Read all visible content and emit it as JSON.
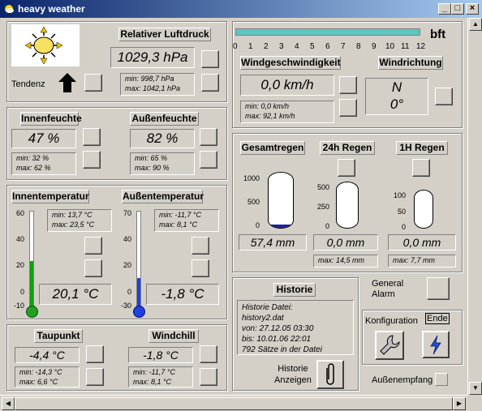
{
  "window": {
    "title": "heavy weather"
  },
  "pressure": {
    "label": "Relativer Luftdruck",
    "value": "1029,3 hPa",
    "min": "min: 998,7 hPa",
    "max": "max: 1042,1 hPa",
    "trend_label": "Tendenz"
  },
  "beaufort": {
    "unit": "bft",
    "ticks": [
      "0",
      "1",
      "2",
      "3",
      "4",
      "5",
      "6",
      "7",
      "8",
      "9",
      "10",
      "11",
      "12"
    ]
  },
  "wind": {
    "speed_label": "Windgeschwindigkeit",
    "speed_value": "0,0 km/h",
    "speed_min": "min: 0,0 km/h",
    "speed_max": "max: 92,1 km/h",
    "dir_label": "Windrichtung",
    "dir_value": "N",
    "dir_deg": "0°"
  },
  "humidity": {
    "in_label": "Innenfeuchte",
    "in_value": "47 %",
    "in_min": "min: 32 %",
    "in_max": "max: 62 %",
    "out_label": "Außenfeuchte",
    "out_value": "82 %",
    "out_min": "min: 65 %",
    "out_max": "max: 90 %"
  },
  "temperature": {
    "in_label": "Innentemperatur",
    "in_value": "20,1 °C",
    "in_min": "min: 13,7 °C",
    "in_max": "max: 23,5 °C",
    "in_ticks": [
      "60",
      "40",
      "20",
      "0",
      "-10"
    ],
    "in_level": 0.47,
    "out_label": "Außentemperatur",
    "out_value": "-1,8 °C",
    "out_min": "min: -11,7 °C",
    "out_max": "max: 8,1 °C",
    "out_ticks": [
      "70",
      "40",
      "20",
      "0",
      "-30"
    ],
    "out_level": 0.29
  },
  "rain": {
    "total_label": "Gesamtregen",
    "total_value": "57,4 mm",
    "total_ticks": [
      "1000",
      "500",
      "0"
    ],
    "total_level": 0.06,
    "h24_label": "24h Regen",
    "h24_value": "0,0 mm",
    "h24_ticks": [
      "500",
      "250",
      "0"
    ],
    "h24_max": "max: 14,5 mm",
    "h24_level": 0,
    "h1_label": "1H Regen",
    "h1_value": "0,0 mm",
    "h1_ticks": [
      "100",
      "50",
      "0"
    ],
    "h1_max": "max: 7,7 mm",
    "h1_level": 0
  },
  "dew": {
    "label": "Taupunkt",
    "value": "-4,4 °C",
    "min": "min: -14,3 °C",
    "max": "max: 6,6 °C"
  },
  "chill": {
    "label": "Windchill",
    "value": "-1,8 °C",
    "min": "min: -11,7 °C",
    "max": "max: 8,1 °C"
  },
  "history": {
    "label": "Historie",
    "file_label": "Historie Datei:",
    "file": "history2.dat",
    "from": "von:  27.12.05 03:30",
    "to": "bis:  10.01.06 22:01",
    "count": "792 Sätze in der Datei",
    "show_label_1": "Historie",
    "show_label_2": "Anzeigen"
  },
  "alarm": {
    "label_1": "General",
    "label_2": "Alarm"
  },
  "config": {
    "label": "Konfiguration",
    "end_label": "Ende"
  },
  "reception": {
    "label": "Außenempfang"
  },
  "colors": {
    "bar": "#5fc4c0",
    "temp_fill": "#10a010",
    "temp_bulb_in": "#20a020",
    "temp_bulb_out": "#2040e0",
    "rain": "#2020a0"
  }
}
